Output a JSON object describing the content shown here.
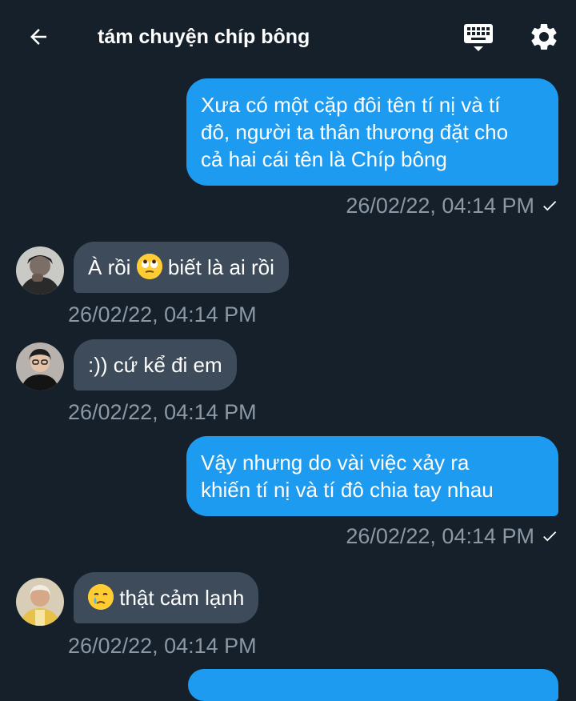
{
  "header": {
    "title": "tám chuyện chíp bông",
    "back_icon": "arrow-left-icon",
    "keyboard_icon": "keyboard-icon",
    "settings_icon": "gear-icon"
  },
  "colors": {
    "background": "#15202b",
    "outgoing_bubble": "#1d9bf0",
    "incoming_bubble": "#3d4b5a",
    "timestamp": "#8b98a5"
  },
  "messages": [
    {
      "direction": "out",
      "text_lines": [
        "Xưa có một cặp đôi tên tí nị và tí",
        "đô, người ta thân thương đặt cho",
        "cả hai cái tên là Chíp bông"
      ],
      "timestamp": "26/02/22, 04:14 PM",
      "read": true
    },
    {
      "direction": "in",
      "emoji": "face-with-rolling-eyes",
      "text_before": "À rồi ",
      "text_after": " biết là ai rồi",
      "timestamp": "26/02/22, 04:14 PM"
    },
    {
      "direction": "in",
      "text": ":)) cứ kể đi em",
      "timestamp": "26/02/22, 04:14 PM"
    },
    {
      "direction": "out",
      "text_lines": [
        "Vậy nhưng do vài việc xảy ra",
        "khiến tí nị và tí đô chia tay nhau"
      ],
      "timestamp": "26/02/22, 04:14 PM",
      "read": true
    },
    {
      "direction": "in",
      "emoji": "crying-face",
      "text_after": " thật cảm lạnh",
      "timestamp": "26/02/22, 04:14 PM"
    }
  ]
}
